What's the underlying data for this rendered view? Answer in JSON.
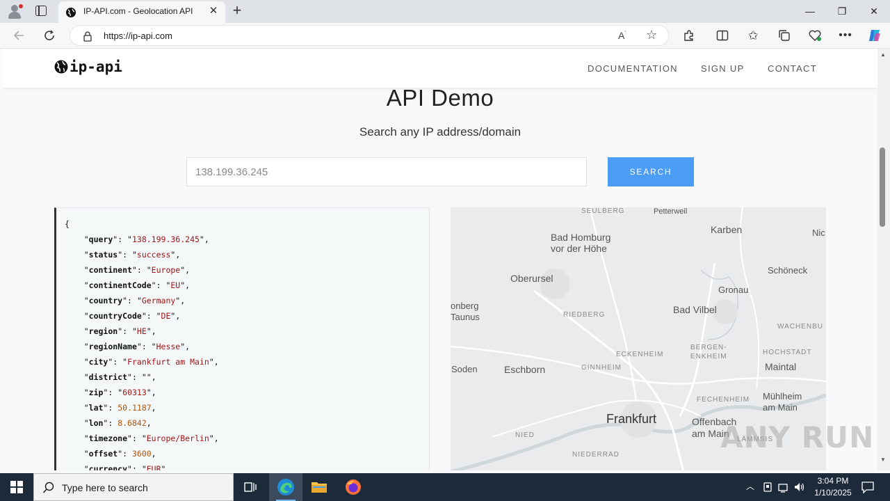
{
  "browser": {
    "tab_title": "IP-API.com - Geolocation API",
    "url": "https://ip-api.com"
  },
  "site": {
    "logo_text": "ip-api",
    "nav": [
      "DOCUMENTATION",
      "SIGN UP",
      "CONTACT"
    ]
  },
  "hero": {
    "title": "API Demo",
    "subtitle": "Search any IP address/domain",
    "search_value": "138.199.36.245",
    "search_button": "SEARCH"
  },
  "json_response": [
    {
      "key": "query",
      "value": "138.199.36.245",
      "type": "string"
    },
    {
      "key": "status",
      "value": "success",
      "type": "string"
    },
    {
      "key": "continent",
      "value": "Europe",
      "type": "string"
    },
    {
      "key": "continentCode",
      "value": "EU",
      "type": "string"
    },
    {
      "key": "country",
      "value": "Germany",
      "type": "string"
    },
    {
      "key": "countryCode",
      "value": "DE",
      "type": "string"
    },
    {
      "key": "region",
      "value": "HE",
      "type": "string"
    },
    {
      "key": "regionName",
      "value": "Hesse",
      "type": "string"
    },
    {
      "key": "city",
      "value": "Frankfurt am Main",
      "type": "string"
    },
    {
      "key": "district",
      "value": "",
      "type": "string"
    },
    {
      "key": "zip",
      "value": "60313",
      "type": "string"
    },
    {
      "key": "lat",
      "value": "50.1187",
      "type": "number"
    },
    {
      "key": "lon",
      "value": "8.6842",
      "type": "number"
    },
    {
      "key": "timezone",
      "value": "Europe/Berlin",
      "type": "string"
    },
    {
      "key": "offset",
      "value": "3600",
      "type": "number"
    },
    {
      "key": "currency",
      "value": "EUR",
      "type": "string"
    }
  ],
  "json_open_brace": "{",
  "map": {
    "labels": {
      "seulberg": "SEULBERG",
      "petterweil": "Petterweil",
      "bad_homburg": "Bad Homburg\nvor der Höhe",
      "karben": "Karben",
      "nic": "Nic",
      "oberursel": "Oberursel",
      "schoeneck": "Schöneck",
      "gronau": "Gronau",
      "kronberg": "onberg\nTaunus",
      "bad_vilbel": "Bad Vilbel",
      "riedberg": "RIEDBERG",
      "wachenbu": "WACHENBU",
      "bergen_enkheim": "BERGEN-\nENKHEIM",
      "hochstadt": "HOCHSTADT",
      "eckenheim": "ECKENHEIM",
      "soden": "Soden",
      "eschborn": "Eschborn",
      "ginnheim": "GINNHEIM",
      "maintal": "Maintal",
      "fechenheim": "FECHENHEIM",
      "muehlheim": "Mühlheim\nam Main",
      "frankfurt": "Frankfurt",
      "offenbach": "Offenbach\nam Main",
      "nied": "NIED",
      "lammsis": "LÄMMSIS",
      "niederrad": "NIEDERRAD"
    }
  },
  "watermark": "ANY RUN",
  "taskbar": {
    "search_placeholder": "Type here to search",
    "time": "3:04 PM",
    "date": "1/10/2025"
  },
  "colors": {
    "accent": "#4b9df5",
    "taskbar": "#1d2a3a",
    "json_string": "#a31515",
    "json_number": "#b45309"
  }
}
